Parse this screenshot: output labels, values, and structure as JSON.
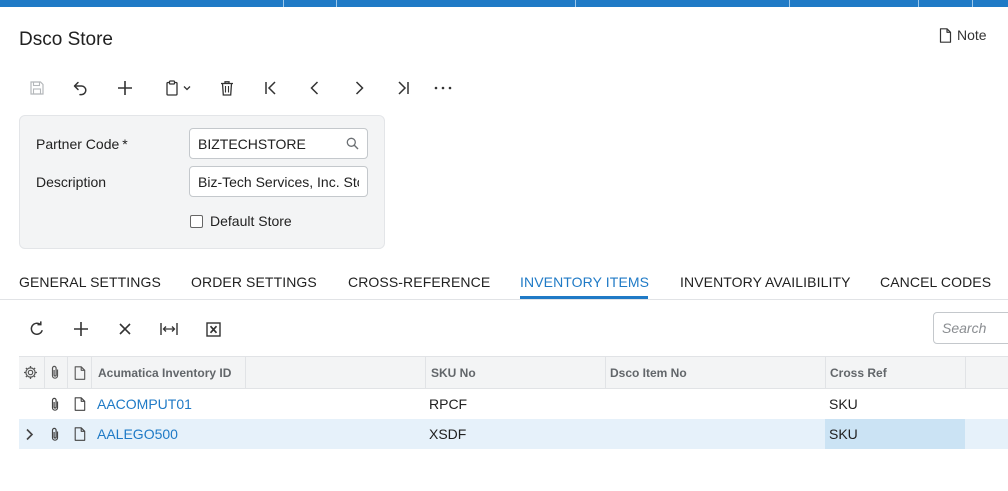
{
  "colors": {
    "accent": "#1f7ac6",
    "panel": "#f3f4f5",
    "selected_row": "#e6f1fa"
  },
  "header": {
    "title": "Dsco Store",
    "note_label": "Note",
    "note_icon": "document-icon"
  },
  "toolbar": {
    "icons": [
      "save-icon",
      "undo-icon",
      "plus-icon",
      "copy-paste-icon",
      "trash-icon",
      "first-icon",
      "previous-icon",
      "next-icon",
      "last-icon",
      "more-icon"
    ]
  },
  "form": {
    "partner_code": {
      "label": "Partner Code",
      "required": "*",
      "value": "BIZTECHSTORE"
    },
    "description": {
      "label": "Description",
      "value": "Biz-Tech Services, Inc. Sto"
    },
    "default_store": {
      "label": "Default Store",
      "checked": false
    }
  },
  "tabs": [
    {
      "label": "GENERAL SETTINGS",
      "active": false
    },
    {
      "label": "ORDER SETTINGS",
      "active": false
    },
    {
      "label": "CROSS-REFERENCE",
      "active": false
    },
    {
      "label": "INVENTORY ITEMS",
      "active": true
    },
    {
      "label": "INVENTORY AVAILIBILITY",
      "active": false
    },
    {
      "label": "CANCEL CODES",
      "active": false
    }
  ],
  "grid_toolbar": {
    "icons": [
      "refresh-icon",
      "add-row-icon",
      "delete-row-icon",
      "fit-columns-icon",
      "export-excel-icon"
    ],
    "search_placeholder": "Search"
  },
  "grid": {
    "columns": [
      "Acumatica Inventory ID",
      "SKU No",
      "Dsco Item No",
      "Cross Ref"
    ],
    "rows": [
      {
        "inventory_id": "AACOMPUT01",
        "sku_no": "RPCF",
        "dsco_item_no": "",
        "cross_ref": "SKU",
        "selected": false
      },
      {
        "inventory_id": "AALEGO500",
        "sku_no": "XSDF",
        "dsco_item_no": "",
        "cross_ref": "SKU",
        "selected": true
      }
    ]
  }
}
